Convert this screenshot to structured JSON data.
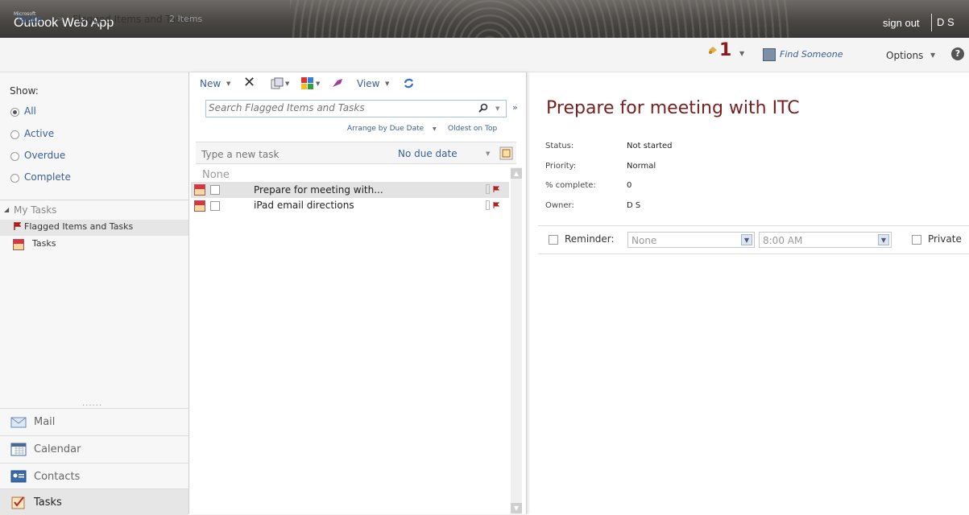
{
  "header": {
    "brand_small": "Microsoft",
    "brand": "Outlook Web App",
    "sign_out": "sign out",
    "user": "D S"
  },
  "breadcrumb": {
    "root": "Tasks",
    "separator": ">",
    "current": "Flagged Items and Tasks",
    "count": "2 Items"
  },
  "topright": {
    "reminder_count": "1",
    "find_someone": "Find Someone",
    "options": "Options",
    "help": "?"
  },
  "leftnav": {
    "show_label": "Show:",
    "filters": [
      {
        "label": "All",
        "selected": true
      },
      {
        "label": "Active",
        "selected": false
      },
      {
        "label": "Overdue",
        "selected": false
      },
      {
        "label": "Complete",
        "selected": false
      }
    ],
    "my_tasks": "My Tasks",
    "folders": [
      "Flagged Items and Tasks",
      "Tasks"
    ],
    "grip": "......",
    "modules": [
      {
        "label": "Mail",
        "icon": "mail-icon"
      },
      {
        "label": "Calendar",
        "icon": "calendar-icon"
      },
      {
        "label": "Contacts",
        "icon": "contacts-icon"
      },
      {
        "label": "Tasks",
        "icon": "tasks-icon"
      }
    ]
  },
  "toolbar": {
    "new": "New",
    "view": "View",
    "search_placeholder": "Search Flagged Items and Tasks",
    "arrange": "Arrange by Due Date",
    "order": "Oldest on Top"
  },
  "newtask": {
    "placeholder": "Type a new task",
    "due": "No due date"
  },
  "list": {
    "group": "None",
    "items": [
      {
        "title": "Prepare for meeting with..."
      },
      {
        "title": "iPad email directions"
      }
    ]
  },
  "reading": {
    "subject": "Prepare for meeting with ITC",
    "fields": [
      {
        "key": "Status:",
        "value": "Not started"
      },
      {
        "key": "Priority:",
        "value": "Normal"
      },
      {
        "key": "% complete:",
        "value": "0"
      },
      {
        "key": "Owner:",
        "value": "D S"
      }
    ],
    "reminder_label": "Reminder:",
    "reminder_date": "None",
    "reminder_time": "8:00 AM",
    "private_label": "Private"
  },
  "colors": {
    "accent": "#3a5f95",
    "subject": "#7a1f1f",
    "header": "#4a4744"
  }
}
